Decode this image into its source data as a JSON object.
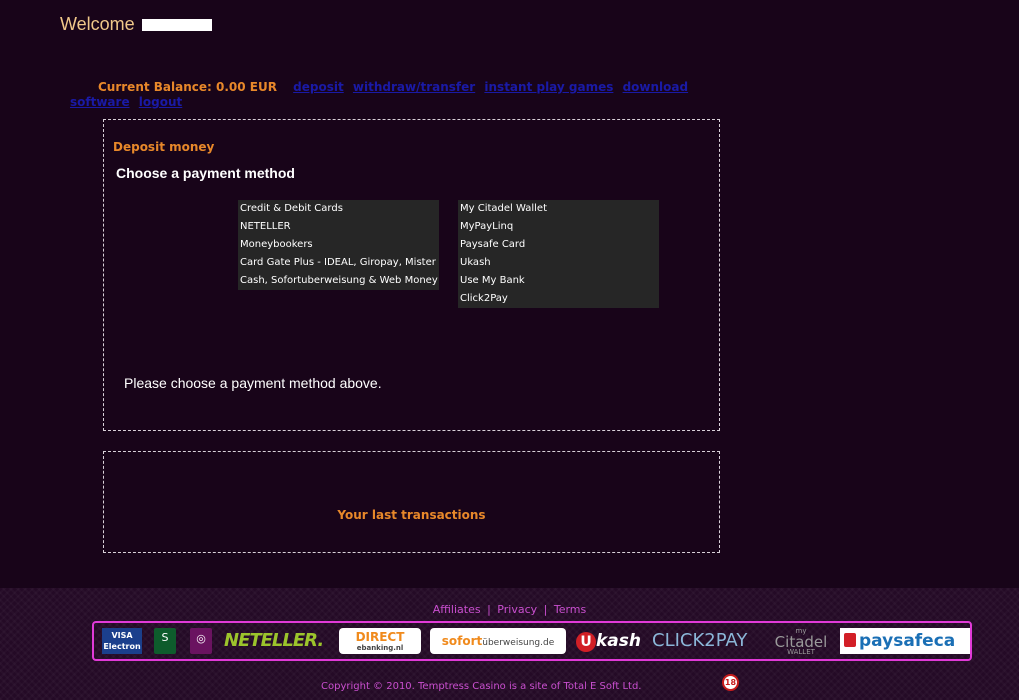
{
  "header": {
    "welcome": "Welcome"
  },
  "nav": {
    "balance": "Current Balance: 0.00 EUR",
    "links": {
      "deposit": "deposit",
      "withdraw": "withdraw/transfer",
      "instant_play": "instant play games",
      "download": "download software",
      "logout": "logout"
    }
  },
  "deposit": {
    "title": "Deposit money",
    "choose_heading": "Choose a payment method",
    "methods_left": [
      "Credit & Debit Cards",
      "NETELLER",
      "Moneybookers",
      "Card Gate Plus - IDEAL, Giropay, Mister",
      "Cash, Sofortuberweisung & Web Money"
    ],
    "methods_right": [
      "My Citadel Wallet",
      "MyPayLinq",
      "Paysafe Card",
      "Ukash",
      "Use My Bank",
      "Click2Pay"
    ],
    "prompt": "Please choose a payment method above."
  },
  "transactions": {
    "title": "Your last transactions"
  },
  "footer": {
    "links": {
      "affiliates": "Affiliates",
      "privacy": "Privacy",
      "terms": "Terms",
      "separator": "|"
    },
    "logos": {
      "visa": "VISA",
      "electron": "Electron",
      "switch": "S",
      "solo": "◎",
      "neteller": "NETELLER.",
      "direct": "DIRECT",
      "direct_sub": "ebanking.nl",
      "sofort": "sofort",
      "sofort_sub": "überweisung.de",
      "ukash_u": "U",
      "ukash": "kash",
      "click2pay": "CLICK2PAY",
      "citadel_my": "my",
      "citadel": "Citadel",
      "citadel_sub": "WALLET",
      "paysafe": "paysafeca"
    },
    "copyright": "Copyright © 2010. Temptress Casino is a site of Total E Soft Ltd.",
    "age_badge": "18"
  },
  "colors": {
    "background": "#180419",
    "accent_orange": "#e8882a",
    "link_blue": "#1a1aa6",
    "footer_pink": "#c94fcf",
    "strip_border": "#e13ad8"
  }
}
